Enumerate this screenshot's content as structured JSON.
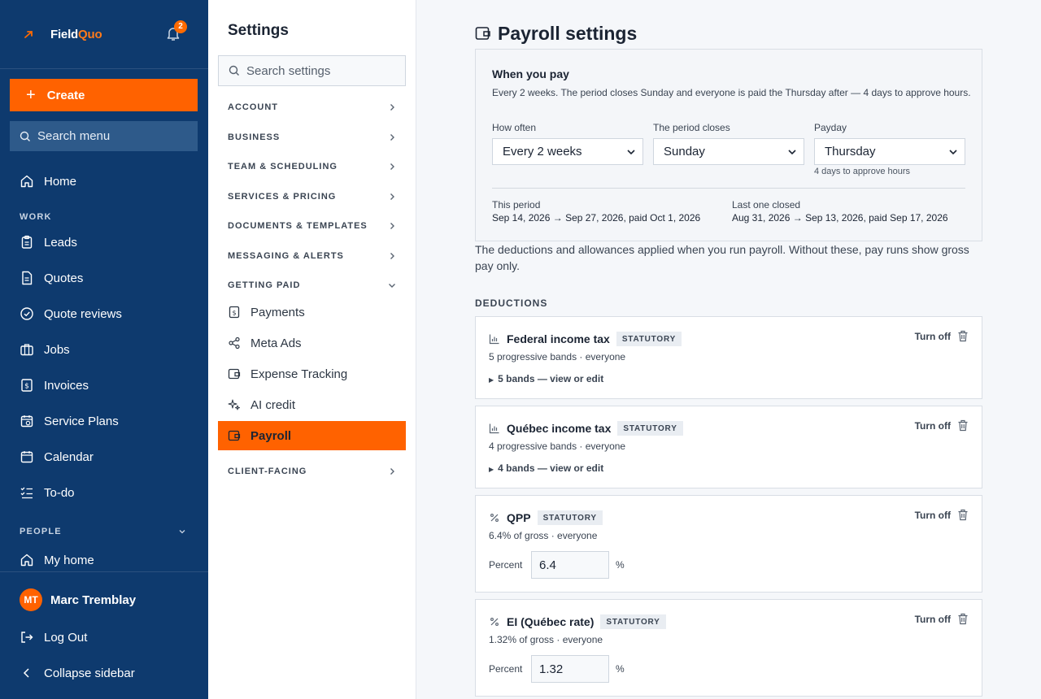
{
  "app": {
    "brand_prefix": "Field",
    "brand_suffix": "Quo",
    "notification_count": "2"
  },
  "nav": {
    "create_label": "Create",
    "search_label": "Search menu",
    "home": "Home",
    "work_section": "WORK",
    "items": [
      "Leads",
      "Quotes",
      "Quote reviews",
      "Jobs",
      "Invoices",
      "Service Plans",
      "Calendar",
      "To-do"
    ],
    "people_section": "PEOPLE",
    "my_home": "My home",
    "user_initials": "MT",
    "user_name": "Marc Tremblay",
    "logout": "Log Out",
    "collapse": "Collapse sidebar"
  },
  "settings": {
    "title": "Settings",
    "search_placeholder": "Search settings",
    "categories": [
      "ACCOUNT",
      "BUSINESS",
      "TEAM & SCHEDULING",
      "SERVICES & PRICING",
      "DOCUMENTS & TEMPLATES",
      "MESSAGING & ALERTS",
      "GETTING PAID"
    ],
    "getting_paid_items": [
      "Payments",
      "Meta Ads",
      "Expense Tracking",
      "AI credit"
    ],
    "active_item": "Payroll",
    "client_facing": "CLIENT-FACING"
  },
  "main": {
    "title": "Payroll settings",
    "pay": {
      "heading": "When you pay",
      "description": "Every 2 weeks. The period closes Sunday and everyone is paid the Thursday after — 4 days to approve hours.",
      "how_often_label": "How often",
      "how_often_value": "Every 2 weeks",
      "closes_label": "The period closes",
      "closes_value": "Sunday",
      "payday_label": "Payday",
      "payday_value": "Thursday",
      "payday_hint": "4 days to approve hours",
      "this_period_label": "This period",
      "this_period_value": "Sep 14, 2026 → Sep 27, 2026, paid Oct 1, 2026",
      "last_closed_label": "Last one closed",
      "last_closed_value": "Aug 31, 2026 → Sep 13, 2026, paid Sep 17, 2026"
    },
    "intro": "The deductions and allowances applied when you run payroll. Without these, pay runs show gross pay only.",
    "deductions_heading": "DEDUCTIONS",
    "deductions": [
      {
        "name": "Federal income tax",
        "badge": "STATUTORY",
        "sub": "5 progressive bands · everyone",
        "toggle": "5 bands — view or edit",
        "action": "Turn off"
      },
      {
        "name": "Québec income tax",
        "badge": "STATUTORY",
        "sub": "4 progressive bands · everyone",
        "toggle": "4 bands — view or edit",
        "action": "Turn off"
      },
      {
        "name": "QPP",
        "badge": "STATUTORY",
        "sub": "6.4% of gross · everyone",
        "percent_label": "Percent",
        "percent_value": "6.4",
        "unit": "%",
        "action": "Turn off"
      },
      {
        "name": "EI (Québec rate)",
        "badge": "STATUTORY",
        "sub": "1.32% of gross · everyone",
        "percent_label": "Percent",
        "percent_value": "1.32",
        "unit": "%",
        "action": "Turn off"
      }
    ]
  }
}
